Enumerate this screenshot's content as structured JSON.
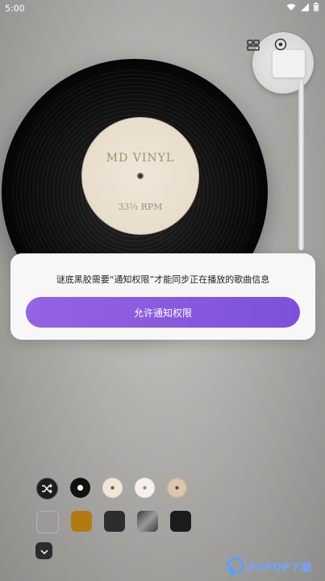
{
  "status_bar": {
    "time": "5:00"
  },
  "turntable": {
    "label_title": "MD VINYL",
    "label_rpm": "33⅓ RPM"
  },
  "top_controls": [
    {
      "icon": "equalizer-icon"
    },
    {
      "icon": "record-settings-icon"
    }
  ],
  "dialog": {
    "message": "谜底黑胶需要“通知权限”才能同步正在播放的歌曲信息",
    "button_label": "允许通知权限"
  },
  "style_options": {
    "row1_icons": [
      "shuffle-icon",
      "black-vinyl-icon",
      "cream-vinyl-icon",
      "white-vinyl-icon",
      "wood-vinyl-icon"
    ],
    "row2_colors": [
      "#9b9a98",
      "#b27b12",
      "#2d2d2d",
      "#6f6f6f",
      "#1c1c1c"
    ]
  },
  "watermark": {
    "text": "PCPOP下载"
  }
}
